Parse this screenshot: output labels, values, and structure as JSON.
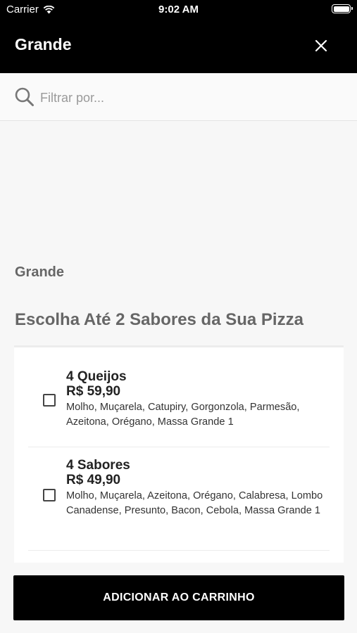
{
  "status_bar": {
    "carrier": "Carrier",
    "time": "9:02 AM"
  },
  "nav": {
    "title": "Grande"
  },
  "search": {
    "placeholder": "Filtrar por..."
  },
  "size_label": "Grande",
  "section_title": "Escolha Até 2 Sabores da Sua Pizza",
  "items": [
    {
      "name": "4 Queijos",
      "price": "R$ 59,90",
      "description": "Molho, Muçarela, Catupiry, Gorgonzola, Parmesão, Azeitona, Orégano, Massa Grande 1",
      "checked": false
    },
    {
      "name": "4 Sabores",
      "price": "R$ 49,90",
      "description": "Molho, Muçarela, Azeitona, Orégano, Calabresa, Lombo Canadense, Presunto, Bacon, Cebola, Massa Grande 1",
      "checked": false
    }
  ],
  "add_button": {
    "label": "ADICIONAR AO CARRINHO"
  },
  "icons": {
    "close": "close-icon",
    "search": "search-icon",
    "wifi": "wifi-icon",
    "battery": "battery-icon"
  }
}
